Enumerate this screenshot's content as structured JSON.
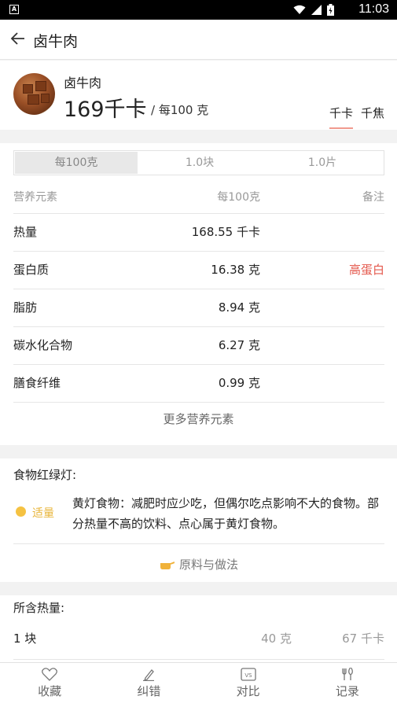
{
  "statusbar": {
    "time": "11:03",
    "app_icon": "A"
  },
  "appbar": {
    "title": "卤牛肉"
  },
  "header": {
    "food_name": "卤牛肉",
    "calories": "169千卡",
    "per_unit": "/ 每100 克",
    "unit_options": [
      "千卡",
      "千焦"
    ],
    "active_unit": "千卡"
  },
  "serving_tabs": [
    "每100克",
    "1.0块",
    "1.0片"
  ],
  "nutrition": {
    "headers": [
      "营养元素",
      "每100克",
      "备注"
    ],
    "rows": [
      {
        "name": "热量",
        "value": "168.55 千卡",
        "note": ""
      },
      {
        "name": "蛋白质",
        "value": "16.38 克",
        "note": "高蛋白"
      },
      {
        "name": "脂肪",
        "value": "8.94 克",
        "note": ""
      },
      {
        "name": "碳水化合物",
        "value": "6.27 克",
        "note": ""
      },
      {
        "name": "膳食纤维",
        "value": "0.99 克",
        "note": ""
      }
    ],
    "more_label": "更多营养元素"
  },
  "traffic_light": {
    "title": "食物红绿灯:",
    "level": "适量",
    "level_color": "#f5c242",
    "description": "黄灯食物：减肥时应少吃，但偶尔吃点影响不大的食物。部分热量不高的饮料、点心属于黄灯食物。",
    "recipe_label": "原料与做法"
  },
  "heat": {
    "title": "所含热量:",
    "rows": [
      {
        "portion": "1 块",
        "weight": "40 克",
        "kcal": "67 千卡"
      }
    ]
  },
  "tabbar": [
    {
      "label": "收藏",
      "icon": "heart-icon"
    },
    {
      "label": "纠错",
      "icon": "pencil-icon"
    },
    {
      "label": "对比",
      "icon": "vs-icon"
    },
    {
      "label": "记录",
      "icon": "utensils-icon"
    }
  ]
}
